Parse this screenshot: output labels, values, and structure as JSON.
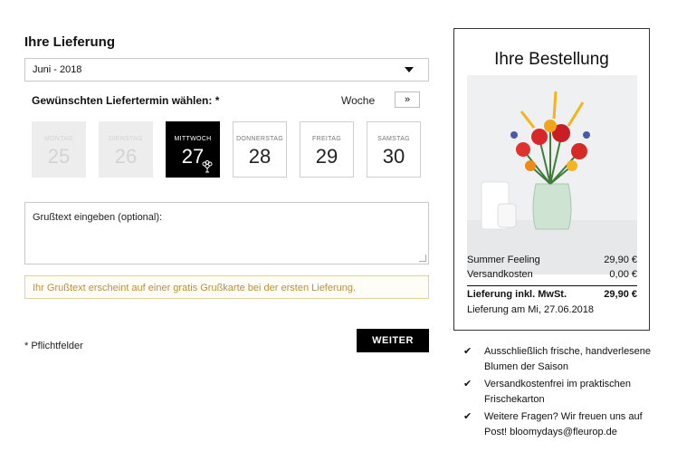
{
  "delivery": {
    "title": "Ihre Lieferung",
    "month_value": "Juni - 2018",
    "date_label": "Gewünschten Liefertermin wählen: *",
    "week_label": "Woche",
    "week_button": "»",
    "days": [
      {
        "name": "MONTAG",
        "number": "25",
        "state": "disabled"
      },
      {
        "name": "DIENSTAG",
        "number": "26",
        "state": "disabled"
      },
      {
        "name": "MITTWOCH",
        "number": "27",
        "state": "selected"
      },
      {
        "name": "DONNERSTAG",
        "number": "28",
        "state": "available"
      },
      {
        "name": "FREITAG",
        "number": "29",
        "state": "available"
      },
      {
        "name": "SAMSTAG",
        "number": "30",
        "state": "available"
      }
    ],
    "greeting_placeholder": "Grußtext eingeben (optional):",
    "notice": "Ihr Grußtext erscheint auf einer gratis Grußkarte bei der ersten Lieferung.",
    "required_note": "* Pflichtfelder",
    "next_button": "WEITER"
  },
  "order": {
    "title": "Ihre Bestellung",
    "product_name": "Summer Feeling",
    "product_price": "29,90 €",
    "shipping_label": "Versandkosten",
    "shipping_price": "0,00 €",
    "total_label": "Lieferung inkl. MwSt.",
    "total_price": "29,90 €",
    "delivery_date": "Lieferung am Mi, 27.06.2018"
  },
  "benefits": [
    "Ausschließlich frische, handverlesene Blumen der Saison",
    "Versandkostenfrei im praktischen Frischekarton",
    "Weitere Fragen? Wir freuen uns auf Post! bloomydays@fleurop.de"
  ],
  "colors": {
    "accent": "#000000",
    "notice_text": "#b8923a",
    "notice_border": "#e3d29a",
    "disabled_bg": "#ededed"
  },
  "icons": {
    "select_caret": "chevron-down-icon",
    "bouquet": "flower-bouquet-icon",
    "check": "checkmark-icon"
  }
}
